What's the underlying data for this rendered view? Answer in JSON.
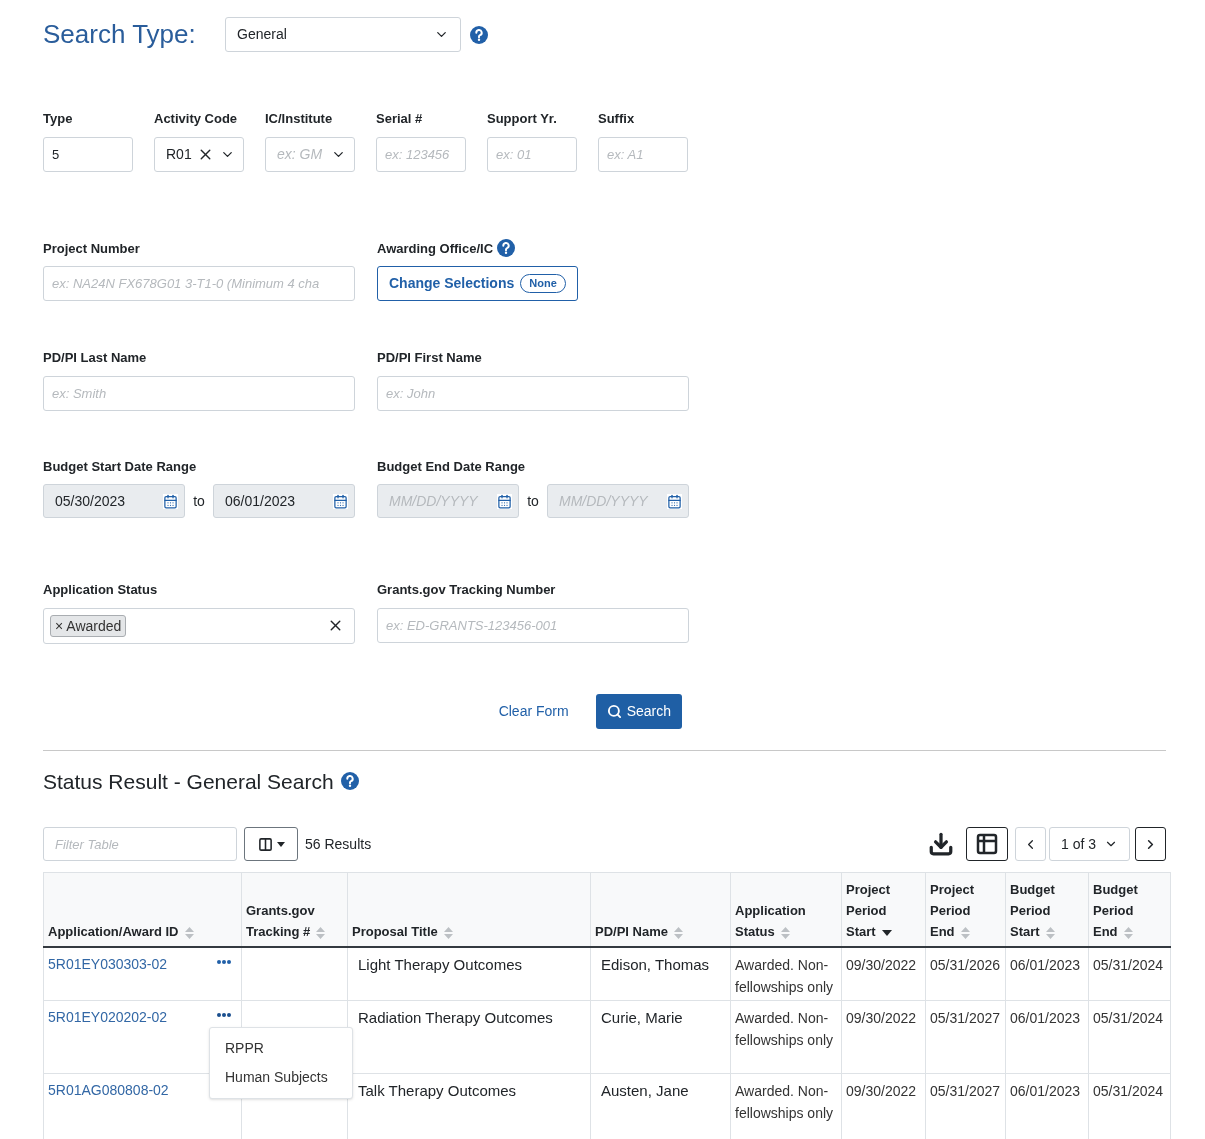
{
  "search_type": {
    "label": "Search Type:",
    "value": "General"
  },
  "id_fields": [
    {
      "label": "Type",
      "kind": "input",
      "value": "5"
    },
    {
      "label": "Activity Code",
      "kind": "select",
      "value": "R01",
      "clearable": true
    },
    {
      "label": "IC/Institute",
      "kind": "select",
      "placeholder": "ex: GM",
      "clearable": false
    },
    {
      "label": "Serial #",
      "kind": "input",
      "placeholder": "ex: 123456"
    },
    {
      "label": "Support Yr.",
      "kind": "input",
      "placeholder": "ex: 01"
    },
    {
      "label": "Suffix",
      "kind": "input",
      "placeholder": "ex: A1"
    }
  ],
  "project_number": {
    "label": "Project Number",
    "placeholder": "ex: NA24N FX678G01 3-T1-0 (Minimum 4 cha"
  },
  "awarding_office": {
    "label": "Awarding Office/IC",
    "button": "Change Selections",
    "badge": "None"
  },
  "pi_last_name": {
    "label": "PD/PI Last Name",
    "placeholder": "ex: Smith"
  },
  "pi_first_name": {
    "label": "PD/PI First Name",
    "placeholder": "ex: John"
  },
  "date_ranges": [
    {
      "label": "Budget Start Date Range",
      "joiner": "to",
      "from": {
        "value": "05/30/2023"
      },
      "to": {
        "value": "06/01/2023"
      }
    },
    {
      "label": "Budget End Date Range",
      "joiner": "to",
      "from": {
        "placeholder": "MM/DD/YYYY"
      },
      "to": {
        "placeholder": "MM/DD/YYYY"
      }
    }
  ],
  "application_status": {
    "label": "Application Status",
    "tags": [
      {
        "remove": "×",
        "label": "Awarded"
      }
    ]
  },
  "tracking_number": {
    "label": "Grants.gov Tracking Number",
    "placeholder": "ex: ED-GRANTS-123456-001"
  },
  "actions": {
    "clear": "Clear Form",
    "search": "Search"
  },
  "results": {
    "title": "Status Result - General Search",
    "filter_placeholder": "Filter Table",
    "count": "56 Results",
    "page": "1 of 3"
  },
  "table": {
    "columns": [
      {
        "label": "Application/Award ID",
        "sorted": false
      },
      {
        "label": "Grants.gov Tracking #",
        "sorted": false
      },
      {
        "label": "Proposal Title",
        "sorted": false
      },
      {
        "label": "PD/PI Name",
        "sorted": false
      },
      {
        "label": "Application Status",
        "sorted": false
      },
      {
        "label": "Project Period Start",
        "sorted": true
      },
      {
        "label": "Project Period End",
        "sorted": false
      },
      {
        "label": "Budget Period Start",
        "sorted": false
      },
      {
        "label": "Budget Period End",
        "sorted": false
      }
    ],
    "row_menu_items": [
      "RPPR",
      "Human Subjects"
    ],
    "rows": [
      {
        "cells": [
          "5R01EY030303-02",
          "",
          "Light Therapy Outcomes",
          "Edison, Thomas",
          "Awarded. Non-fellowships only",
          "09/30/2022",
          "05/31/2026",
          "06/01/2023",
          "05/31/2024"
        ],
        "menu_open": false
      },
      {
        "cells": [
          "5R01EY020202-02",
          "",
          "Radiation Therapy Outcomes",
          "Curie, Marie",
          "Awarded. Non-fellowships only",
          "09/30/2022",
          "05/31/2027",
          "06/01/2023",
          "05/31/2024"
        ],
        "menu_open": true
      },
      {
        "cells": [
          "5R01AG080808-02",
          "",
          "Talk Therapy Outcomes",
          "Austen, Jane",
          "Awarded. Non-fellowships only",
          "09/30/2022",
          "05/31/2027",
          "06/01/2023",
          "05/31/2024"
        ],
        "menu_open": false
      }
    ]
  }
}
